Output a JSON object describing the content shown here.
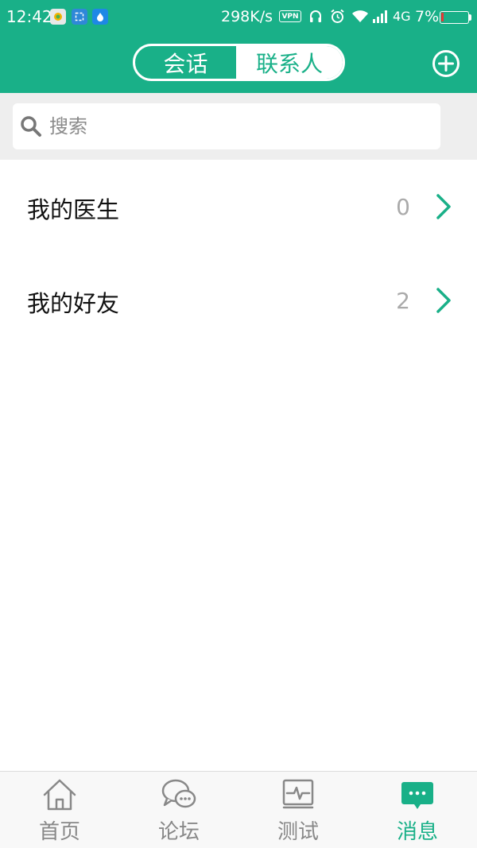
{
  "status_bar": {
    "time": "12:42",
    "network_speed": "298K/s",
    "vpn": "VPN",
    "network_type": "4G",
    "battery": "7%"
  },
  "header": {
    "tabs": [
      "会话",
      "联系人"
    ],
    "active_tab": 1,
    "add_icon": "plus-circle-icon"
  },
  "search": {
    "placeholder": "搜索"
  },
  "contacts": [
    {
      "label": "我的医生",
      "count": "0"
    },
    {
      "label": "我的好友",
      "count": "2"
    }
  ],
  "bottom_nav": [
    {
      "label": "首页",
      "icon": "home-icon"
    },
    {
      "label": "论坛",
      "icon": "chat-bubbles-icon"
    },
    {
      "label": "测试",
      "icon": "pulse-test-icon"
    },
    {
      "label": "消息",
      "icon": "message-icon",
      "active": true
    }
  ],
  "colors": {
    "accent": "#19b088",
    "inactive": "#888888"
  }
}
